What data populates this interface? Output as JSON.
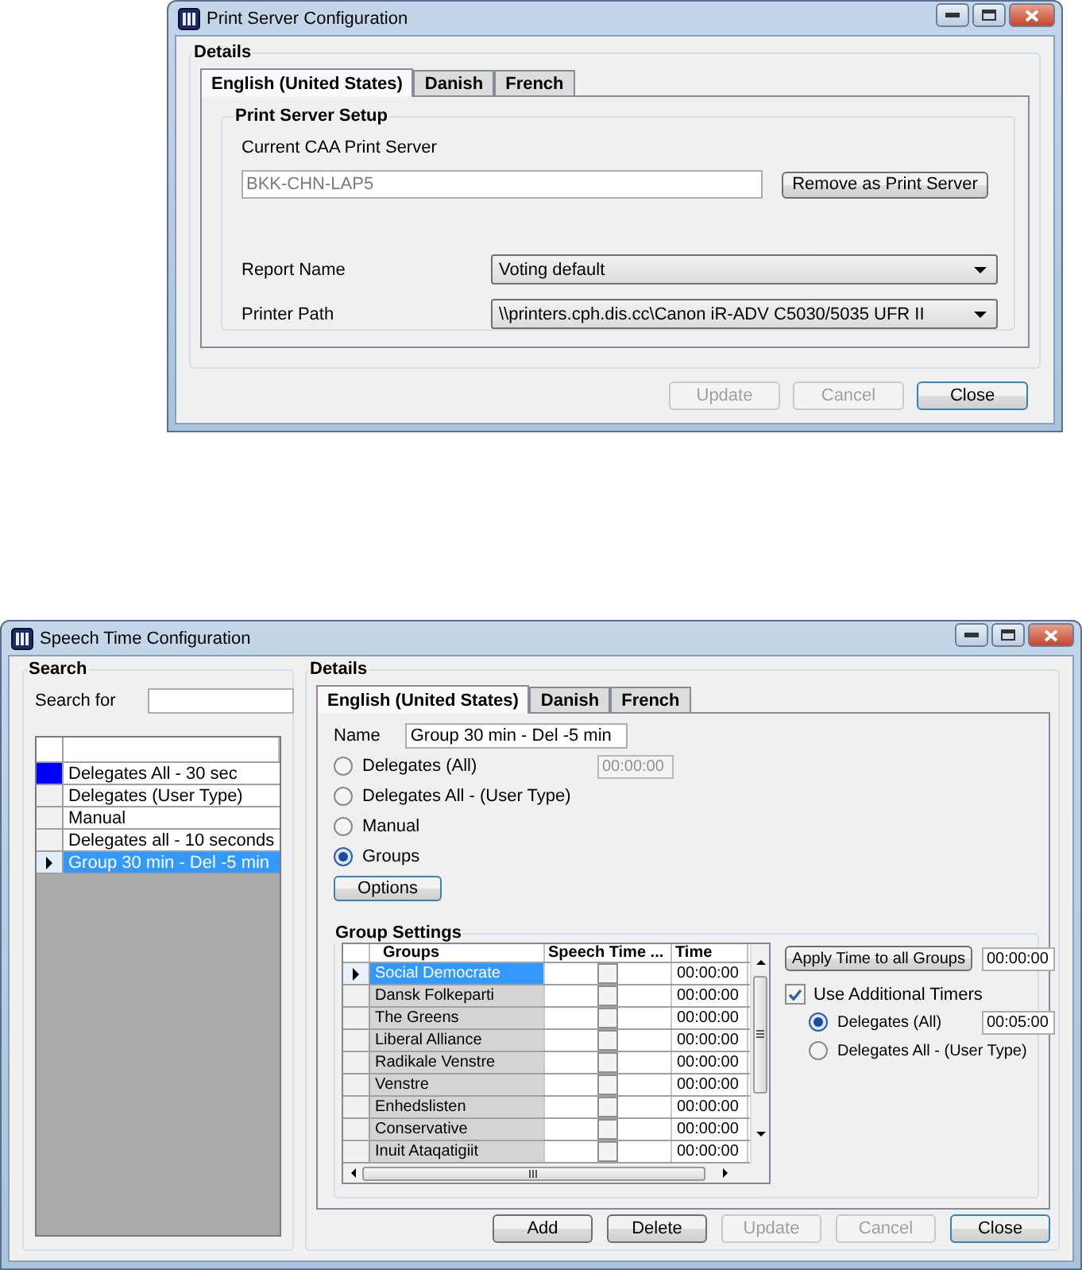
{
  "print_window": {
    "title": "Print Server Configuration",
    "details_label": "Details",
    "tabs": [
      {
        "label": "English (United States)",
        "selected": true
      },
      {
        "label": "Danish",
        "selected": false
      },
      {
        "label": "French",
        "selected": false
      }
    ],
    "setup_label": "Print Server Setup",
    "server_label": "Current CAA Print Server",
    "server_value": "BKK-CHN-LAP5",
    "remove_button": "Remove as Print Server",
    "fields": [
      {
        "label": "Report Name",
        "value": "Voting default"
      },
      {
        "label": "Printer Path",
        "value": "\\\\printers.cph.dis.cc\\Canon iR-ADV C5030/5035 UFR II"
      }
    ],
    "buttons": [
      {
        "label": "Update",
        "disabled": true
      },
      {
        "label": "Cancel",
        "disabled": true
      },
      {
        "label": "Close",
        "disabled": false
      }
    ]
  },
  "speech_window": {
    "title": "Speech Time Configuration",
    "search_label": "Search",
    "search_for_label": "Search for",
    "list": [
      {
        "label": "Delegates All - 30 sec",
        "selected": false,
        "color": "#0000ff"
      },
      {
        "label": "Delegates (User Type)",
        "selected": false
      },
      {
        "label": "Manual",
        "selected": false
      },
      {
        "label": "Delegates all - 10 seconds",
        "selected": false
      },
      {
        "label": "Group 30 min - Del -5 min",
        "selected": true
      }
    ],
    "details_label": "Details",
    "tabs": [
      {
        "label": "English (United States)",
        "selected": true
      },
      {
        "label": "Danish",
        "selected": false
      },
      {
        "label": "French",
        "selected": false
      }
    ],
    "name_label": "Name",
    "name_value": "Group 30 min - Del -5 min",
    "modes": [
      {
        "label": "Delegates (All)",
        "selected": false,
        "time": {
          "value": "00:00:00",
          "disabled": true
        }
      },
      {
        "label": "Delegates All - (User Type)",
        "selected": false
      },
      {
        "label": "Manual",
        "selected": false
      },
      {
        "label": "Groups",
        "selected": true
      }
    ],
    "options_button": "Options",
    "group_settings_label": "Group Settings",
    "columns": [
      "Groups",
      "Speech Time ...",
      "Time"
    ],
    "rows": [
      {
        "group": "Social Democrate",
        "checked": false,
        "time": "00:00:00",
        "selected": true
      },
      {
        "group": "Dansk Folkeparti",
        "checked": false,
        "time": "00:00:00",
        "selected": false
      },
      {
        "group": "The Greens",
        "checked": false,
        "time": "00:00:00",
        "selected": false
      },
      {
        "group": "Liberal Alliance",
        "checked": false,
        "time": "00:00:00",
        "selected": false
      },
      {
        "group": "Radikale Venstre",
        "checked": false,
        "time": "00:00:00",
        "selected": false
      },
      {
        "group": "Venstre",
        "checked": false,
        "time": "00:00:00",
        "selected": false
      },
      {
        "group": "Enhedslisten",
        "checked": false,
        "time": "00:00:00",
        "selected": false
      },
      {
        "group": "Conservative",
        "checked": false,
        "time": "00:00:00",
        "selected": false
      },
      {
        "group": "Inuit Ataqatigiit",
        "checked": false,
        "time": "00:00:00",
        "selected": false
      }
    ],
    "apply_button": "Apply Time to all Groups",
    "apply_time": "00:00:00",
    "additional_timers": {
      "label": "Use Additional Timers",
      "checked": true
    },
    "timer_options": [
      {
        "label": "Delegates (All)",
        "selected": true,
        "time": "00:05:00"
      },
      {
        "label": "Delegates All - (User Type)",
        "selected": false
      }
    ],
    "buttons": [
      {
        "label": "Add",
        "disabled": false
      },
      {
        "label": "Delete",
        "disabled": false
      },
      {
        "label": "Update",
        "disabled": true
      },
      {
        "label": "Cancel",
        "disabled": true
      },
      {
        "label": "Close",
        "disabled": false
      }
    ]
  }
}
